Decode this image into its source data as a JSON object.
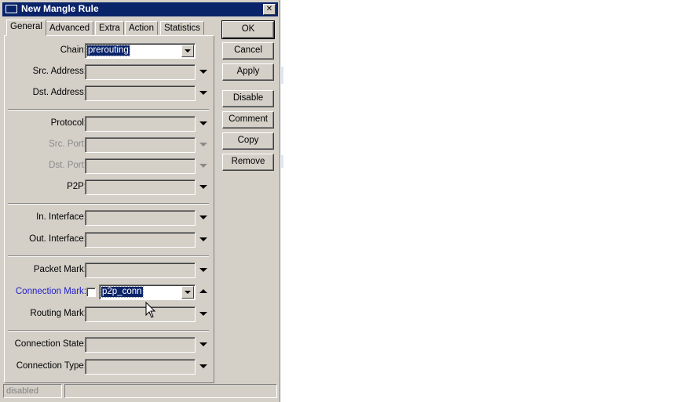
{
  "window": {
    "title": "New Mangle Rule",
    "close_glyph": "✕"
  },
  "tabs": [
    "General",
    "Advanced",
    "Extra",
    "Action",
    "Statistics"
  ],
  "fields": {
    "chain": {
      "label": "Chain:",
      "value": "prerouting"
    },
    "src_address": {
      "label": "Src. Address:"
    },
    "dst_address": {
      "label": "Dst. Address:"
    },
    "protocol": {
      "label": "Protocol:"
    },
    "src_port": {
      "label": "Src. Port:"
    },
    "dst_port": {
      "label": "Dst. Port:"
    },
    "p2p": {
      "label": "P2P:"
    },
    "in_interface": {
      "label": "In. Interface:"
    },
    "out_interface": {
      "label": "Out. Interface:"
    },
    "packet_mark": {
      "label": "Packet Mark:"
    },
    "connection_mark": {
      "label": "Connection Mark:",
      "value": "p2p_conn",
      "negate_checked": false
    },
    "routing_mark": {
      "label": "Routing Mark:"
    },
    "connection_state": {
      "label": "Connection State:"
    },
    "connection_type": {
      "label": "Connection Type:"
    }
  },
  "buttons": {
    "ok": "OK",
    "cancel": "Cancel",
    "apply": "Apply",
    "disable": "Disable",
    "comment": "Comment",
    "copy": "Copy",
    "remove": "Remove"
  },
  "status": {
    "text": "disabled"
  },
  "colors": {
    "titlebar": "#0a246a",
    "face": "#d4d0c8",
    "label_highlight": "#2020c8",
    "disabled_text": "#8a8a8a"
  }
}
